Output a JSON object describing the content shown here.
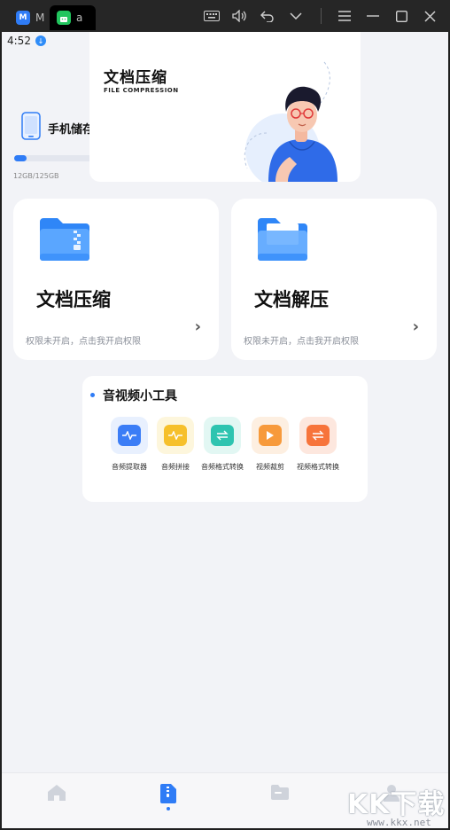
{
  "window": {
    "tabs": [
      {
        "label": "M",
        "icon": "blue-app-icon"
      },
      {
        "label": "a",
        "icon": "android-icon"
      }
    ],
    "controls": [
      "keyboard-icon",
      "volume-icon",
      "undo-icon",
      "chevron-down-icon",
      "menu-icon",
      "minimize-icon",
      "maximize-icon",
      "close-icon"
    ]
  },
  "statusbar": {
    "time": "4:52"
  },
  "storage": {
    "title": "手机储存空间",
    "size": "12GB/125GB",
    "percent": "9%",
    "used_fraction": 0.09
  },
  "banner": {
    "title": "文档压缩",
    "subtitle": "FILE COMPRESSION"
  },
  "features": [
    {
      "title": "文档压缩",
      "note": "权限未开启，点击我开启权限"
    },
    {
      "title": "文档解压",
      "note": "权限未开启，点击我开启权限"
    }
  ],
  "tools": {
    "title": "音视频小工具",
    "items": [
      {
        "label": "音频提取器",
        "icon": "audio-extract-icon",
        "color": "#3b7df6",
        "bg": "#e8f0fe"
      },
      {
        "label": "音频拼接",
        "icon": "audio-splice-icon",
        "color": "#f6c02b",
        "bg": "#fdf6dc"
      },
      {
        "label": "音频格式转换",
        "icon": "audio-convert-icon",
        "color": "#2ec4b0",
        "bg": "#e2f7f3"
      },
      {
        "label": "视频裁剪",
        "icon": "video-crop-icon",
        "color": "#f79a3b",
        "bg": "#fdefe1"
      },
      {
        "label": "视频格式转换",
        "icon": "video-convert-icon",
        "color": "#f7743b",
        "bg": "#fde7de"
      }
    ]
  },
  "nav": {
    "items": [
      "home-icon",
      "document-icon",
      "folder-icon",
      "profile-icon"
    ],
    "active": 1
  },
  "watermark": {
    "main": "KK下载",
    "url": "www.kkx.net"
  }
}
